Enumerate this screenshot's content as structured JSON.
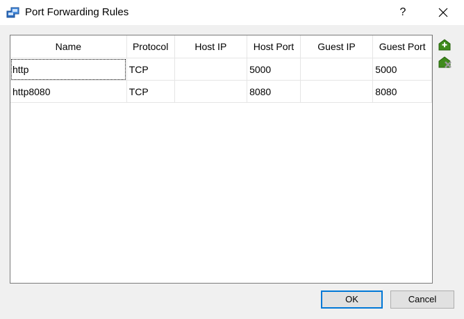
{
  "window": {
    "title": "Port Forwarding Rules",
    "help": "?"
  },
  "table": {
    "columns": [
      "Name",
      "Protocol",
      "Host IP",
      "Host Port",
      "Guest IP",
      "Guest Port"
    ],
    "rows": [
      [
        "http",
        "TCP",
        "",
        "5000",
        "",
        "5000"
      ],
      [
        "http8080",
        "TCP",
        "",
        "8080",
        "",
        "8080"
      ]
    ]
  },
  "buttons": {
    "ok": "OK",
    "cancel": "Cancel"
  },
  "icons": {
    "app": "network-adapter-icon",
    "add": "add-rule-icon",
    "remove": "remove-rule-icon",
    "close": "close-icon"
  },
  "colors": {
    "accent": "#0078d7",
    "rule_icon": "#3f8a1c"
  }
}
